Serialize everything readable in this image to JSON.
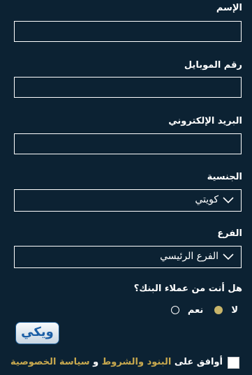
{
  "form": {
    "name_label": "الإسم",
    "name_value": "",
    "mobile_label": "رقم الموبايل",
    "mobile_value": "",
    "email_label": "البريد الإلكتروني",
    "email_value": "",
    "nationality_label": "الجنسية",
    "nationality_selected": "كويتي",
    "branch_label": "الفرع",
    "branch_selected": "الفرع الرئيسي",
    "customer_question": "هل أنت من عملاء البنك؟",
    "option_no": "لا",
    "option_yes": "نعم",
    "selected_option": "لا"
  },
  "agreement": {
    "prefix": "أوافق على",
    "terms": "البنود والشروط",
    "and": "و",
    "privacy": "سياسة الخصوصية",
    "checked": false
  },
  "logo": {
    "text": "ويكي",
    "icon": "weki-logo"
  },
  "colors": {
    "background": "#0c2233",
    "accent": "#c8a94f",
    "radio_selected": "#c8b56a"
  }
}
